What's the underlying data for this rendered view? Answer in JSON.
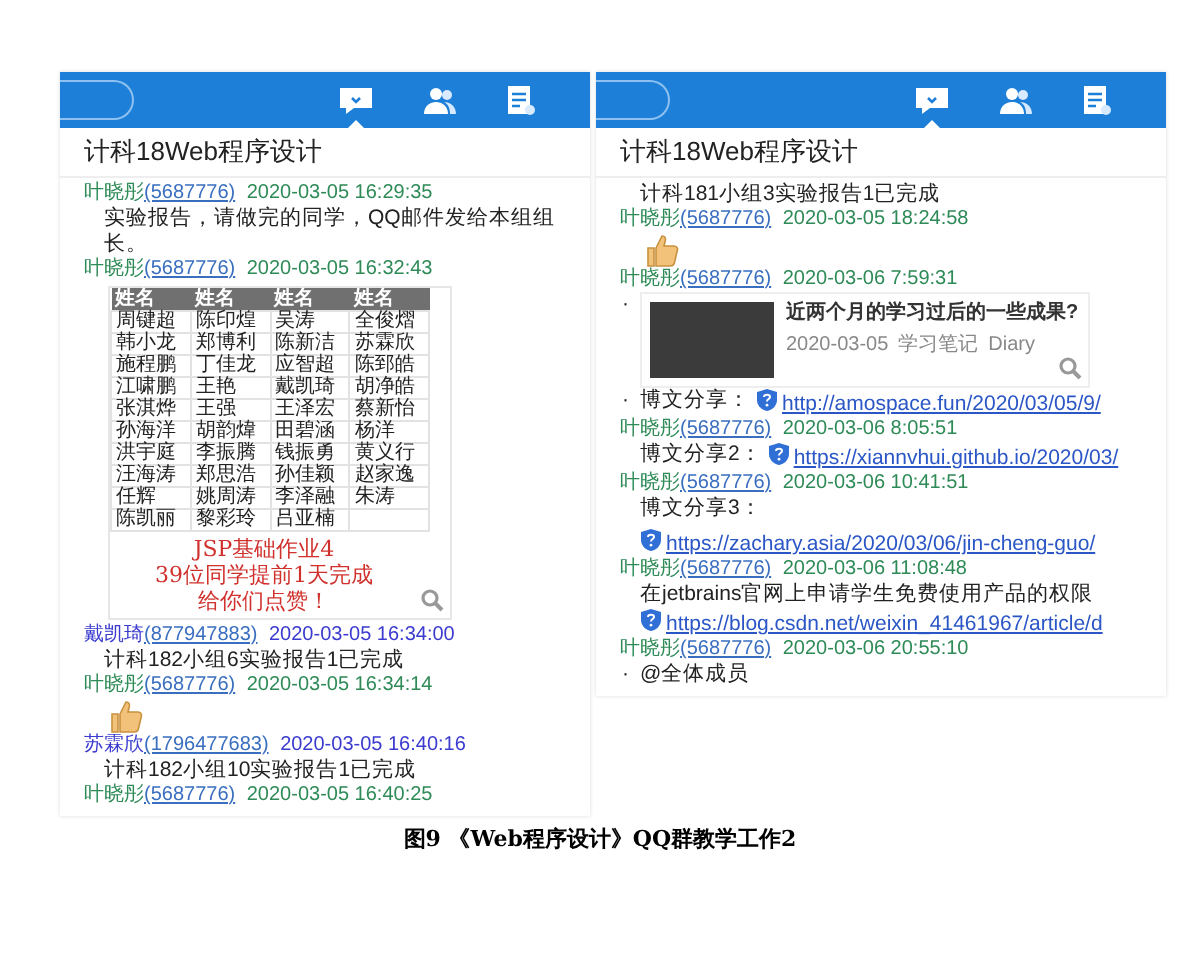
{
  "panels": [
    {
      "tabs": [
        {
          "kind": "chat",
          "selected": true
        },
        {
          "kind": "contacts",
          "selected": false
        },
        {
          "kind": "files",
          "selected": false
        }
      ],
      "title": "计科18Web程序设计",
      "messages": [
        {
          "kind": "meta",
          "sender": "叶晓彤",
          "qq": "(5687776)",
          "time": "2020-03-05 16:29:35",
          "color": "#2e8b57"
        },
        {
          "kind": "text",
          "text": "实验报告，请做完的同学，QQ邮件发给本组组长。"
        },
        {
          "kind": "meta",
          "sender": "叶晓彤",
          "qq": "(5687776)",
          "time": "2020-03-05 16:32:43",
          "color": "#2e8b57"
        },
        {
          "kind": "image_table",
          "header": [
            "姓名",
            "姓名",
            "姓名",
            "姓名"
          ],
          "rows": [
            [
              "周键超",
              "陈印煌",
              "吴涛",
              "全俊熠"
            ],
            [
              "韩小龙",
              "郑博利",
              "陈新洁",
              "苏霖欣"
            ],
            [
              "施程鹏",
              "丁佳龙",
              "应智超",
              "陈郅皓"
            ],
            [
              "江啸鹏",
              "王艳",
              "戴凯琦",
              "胡净皓"
            ],
            [
              "张淇烨",
              "王强",
              "王泽宏",
              "蔡新怡"
            ],
            [
              "孙海洋",
              "胡韵煒",
              "田碧涵",
              "杨洋"
            ],
            [
              "洪宇庭",
              "李振腾",
              "钱振勇",
              "黄义行"
            ],
            [
              "汪海涛",
              "郑思浩",
              "孙佳颖",
              "赵家逸"
            ],
            [
              "任辉",
              "姚周涛",
              "李泽融",
              "朱涛"
            ],
            [
              "陈凯丽",
              "黎彩玲",
              "吕亚楠",
              ""
            ]
          ],
          "caption": [
            "JSP基础作业4",
            "39位同学提前1天完成",
            "给你们点赞！"
          ]
        },
        {
          "kind": "meta",
          "sender": "戴凯琦",
          "qq": "(877947883)",
          "time": "2020-03-05 16:34:00",
          "color": "#3b3bcf"
        },
        {
          "kind": "text",
          "text": "计科182小组6实验报告1已完成"
        },
        {
          "kind": "meta",
          "sender": "叶晓彤",
          "qq": "(5687776)",
          "time": "2020-03-05 16:34:14",
          "color": "#2e8b57"
        },
        {
          "kind": "thumb"
        },
        {
          "kind": "meta",
          "sender": "苏霖欣",
          "qq": "(1796477683)",
          "time": "2020-03-05 16:40:16",
          "color": "#3b3bcf"
        },
        {
          "kind": "text",
          "text": "计科182小组10实验报告1已完成"
        },
        {
          "kind": "meta",
          "sender": "叶晓彤",
          "qq": "(5687776)",
          "time": "2020-03-05 16:40:25",
          "color": "#2e8b57"
        }
      ]
    },
    {
      "tabs": [
        {
          "kind": "chat",
          "selected": true
        },
        {
          "kind": "contacts",
          "selected": false
        },
        {
          "kind": "files",
          "selected": false
        }
      ],
      "title": "计科18Web程序设计",
      "messages": [
        {
          "kind": "text",
          "text": "计科181小组3实验报告1已完成"
        },
        {
          "kind": "meta",
          "sender": "叶晓彤",
          "qq": "(5687776)",
          "time": "2020-03-05 18:24:58",
          "color": "#2e8b57"
        },
        {
          "kind": "thumb"
        },
        {
          "kind": "meta",
          "sender": "叶晓彤",
          "qq": "(5687776)",
          "time": "2020-03-06 7:59:31",
          "color": "#2e8b57"
        },
        {
          "kind": "card",
          "bullet": "·",
          "title": "近两个月的学习过后的一些成果?",
          "date": "2020-03-05",
          "tag": "学习笔记",
          "category": "Diary"
        },
        {
          "kind": "share",
          "bullet": "·",
          "label": "博文分享：",
          "url": "http://amospace.fun/2020/03/05/9/"
        },
        {
          "kind": "meta",
          "sender": "叶晓彤",
          "qq": "(5687776)",
          "time": "2020-03-06 8:05:51",
          "color": "#2e8b57"
        },
        {
          "kind": "share",
          "label": "博文分享2：",
          "url": "https://xiannvhui.github.io/2020/03/"
        },
        {
          "kind": "meta",
          "sender": "叶晓彤",
          "qq": "(5687776)",
          "time": "2020-03-06 10:41:51",
          "color": "#2e8b57"
        },
        {
          "kind": "share",
          "label": "博文分享3：",
          "url": "https://zachary.asia/2020/03/06/jin-cheng-guo/"
        },
        {
          "kind": "meta",
          "sender": "叶晓彤",
          "qq": "(5687776)",
          "time": "2020-03-06 11:08:48",
          "color": "#2e8b57"
        },
        {
          "kind": "text",
          "text": "在jetbrains官网上申请学生免费使用产品的权限"
        },
        {
          "kind": "share",
          "url": "https://blog.csdn.net/weixin_41461967/article/d"
        },
        {
          "kind": "meta",
          "sender": "叶晓彤",
          "qq": "(5687776)",
          "time": "2020-03-06 20:55:10",
          "color": "#2e8b57"
        },
        {
          "kind": "text",
          "bullet": "·",
          "text": "@全体成员"
        }
      ]
    }
  ],
  "caption": "图9 《Web程序设计》QQ群教学工作2"
}
